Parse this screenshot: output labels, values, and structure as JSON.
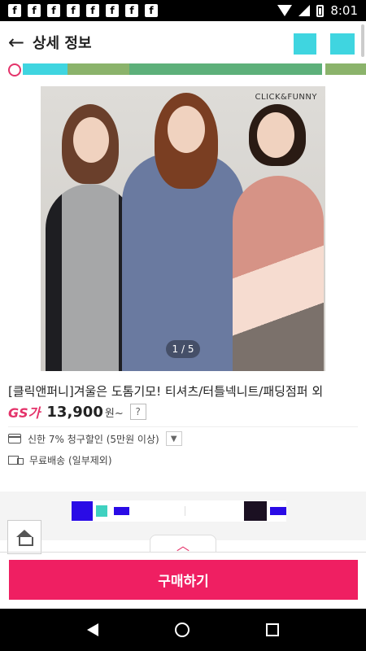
{
  "status_bar": {
    "time": "8:01",
    "app_icons": [
      "f",
      "f",
      "f",
      "f",
      "f",
      "f",
      "f",
      "f"
    ]
  },
  "header": {
    "title": "상세 정보",
    "back_icon": "back-arrow-icon"
  },
  "category_strip": {
    "clock_icon": "clock-icon",
    "segments": [
      "#3fd5e0",
      "#8bb36b",
      "#5db07a",
      "#8bb36b"
    ]
  },
  "product": {
    "brand_mark": "CLICK&FUNNY",
    "image_indicator": "1 / 5",
    "title": "[클릭앤퍼니]겨울은 도톰기모! 티셔츠/터틀넥니트/패딩점퍼 외",
    "shop_logo": "GS가",
    "price": "13,900",
    "price_unit": "원~",
    "help_label": "?",
    "card_discount": "신한 7% 청구할인 (5만원 이상)",
    "shipping": "무료배송 (일부제외)"
  },
  "bottom": {
    "expand_icon": "chevron-up-icon",
    "buy_label": "구매하기"
  },
  "colors": {
    "accent": "#ef1f62",
    "brand_pink": "#e4336a"
  }
}
